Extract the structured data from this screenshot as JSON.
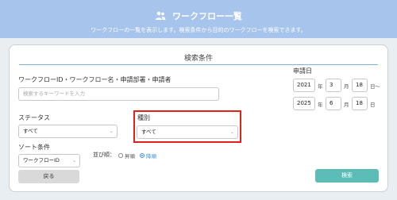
{
  "header": {
    "title": "ワークフロー一覧",
    "description": "ワークフローの一覧を表示します。検索条件から目的のワークフローを検索できます。",
    "icon": "users-icon"
  },
  "panel": {
    "title": "検索条件",
    "keyword": {
      "label": "ワークフローID・ワークフロー名・申請部署・申請者",
      "placeholder": "検索するキーワードを入力"
    },
    "status": {
      "label": "ステータス",
      "value": "すべて"
    },
    "type": {
      "label": "種別",
      "value": "すべて"
    },
    "sort": {
      "label": "ソート条件",
      "value": "ワークフローID",
      "order_label": "並び順：",
      "options": [
        "昇順",
        "降順"
      ],
      "selected": "降順"
    },
    "date": {
      "label": "申請日",
      "from": {
        "year": "2021",
        "month": "3",
        "day": "18"
      },
      "to": {
        "year": "2025",
        "month": "6",
        "day": "18"
      },
      "year_unit": "年",
      "month_unit": "月",
      "day_unit": "日",
      "range_sep": "〜"
    },
    "back_label": "戻る",
    "search_label": "検索"
  },
  "colors": {
    "header": "#a7c4ec",
    "search_button": "#5bbdb6",
    "highlight": "#e0221b",
    "divider": "#7fb2d8"
  }
}
